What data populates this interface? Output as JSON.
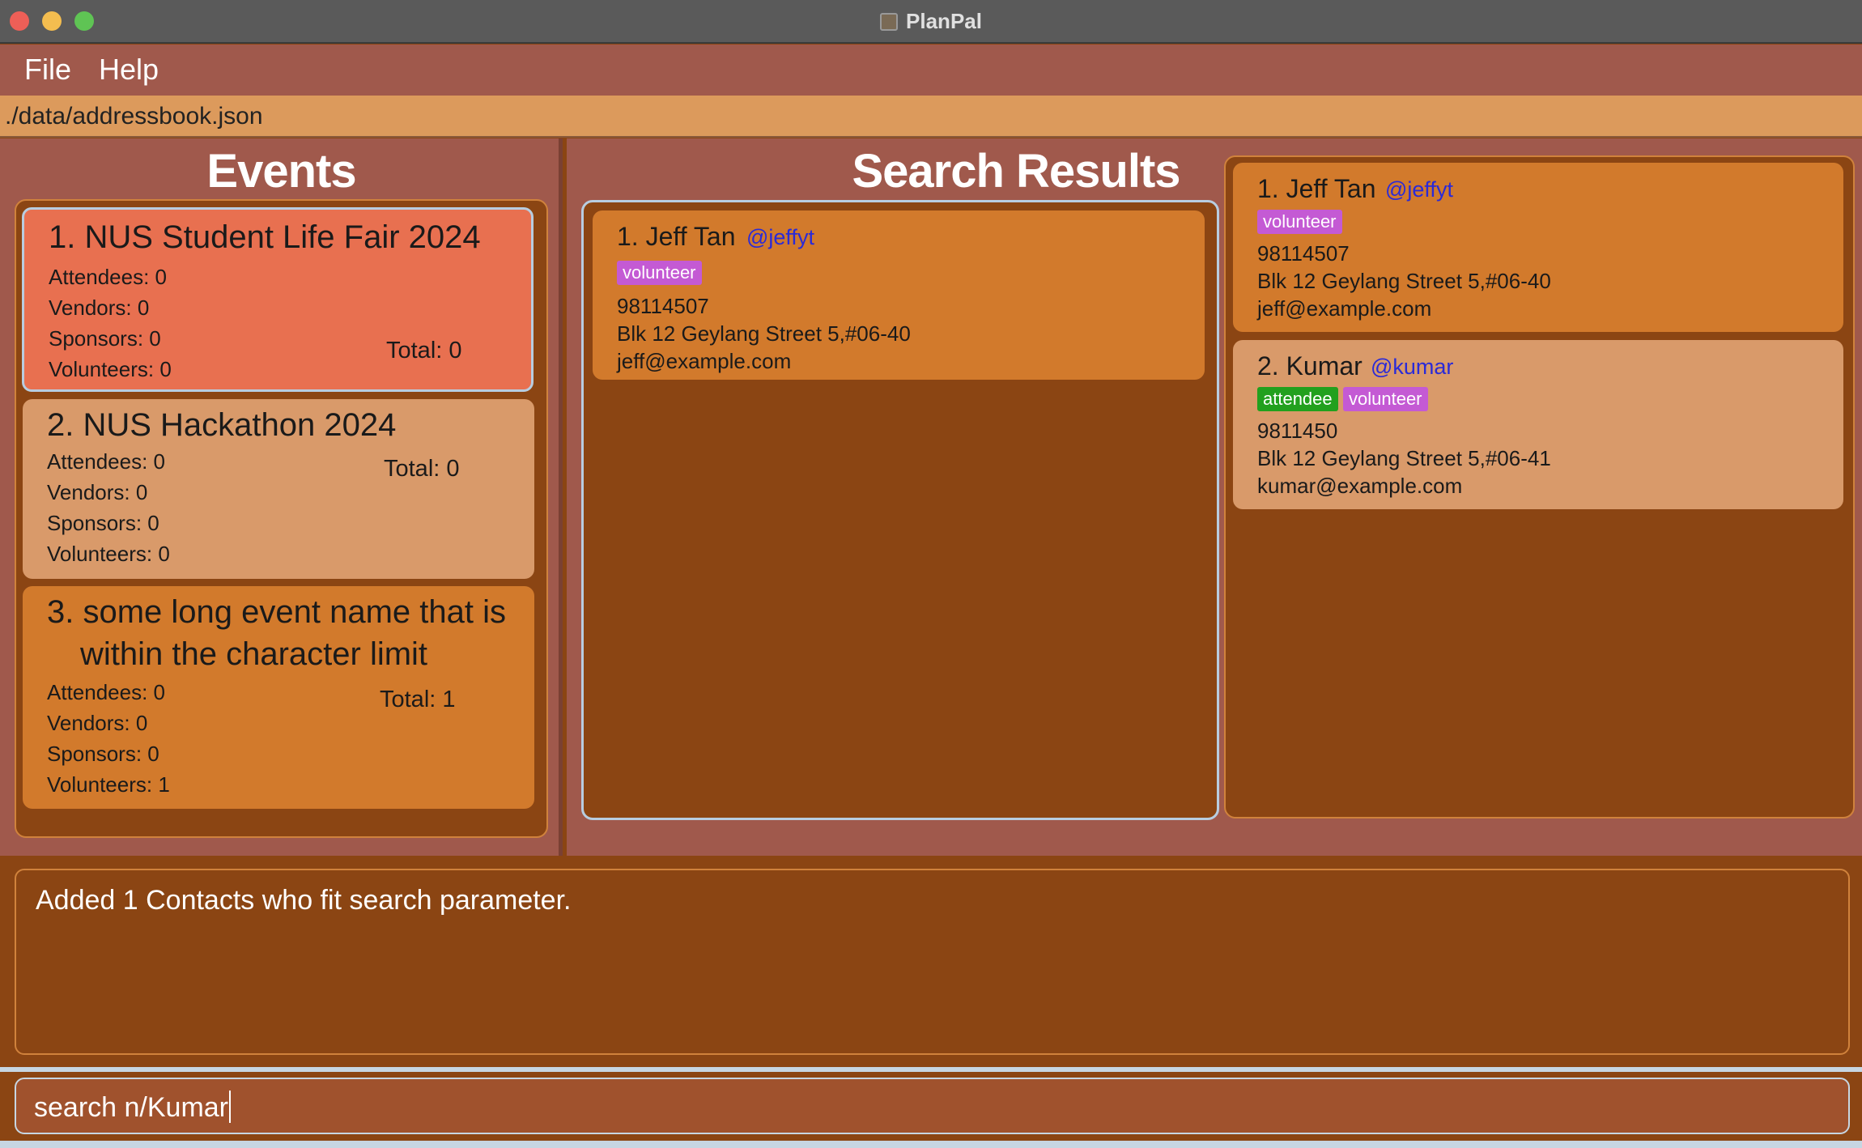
{
  "window": {
    "title": "PlanPal"
  },
  "menu": {
    "items": [
      "File",
      "Help"
    ]
  },
  "path": "./data/addressbook.json",
  "events_panel": {
    "title": "Events",
    "events": [
      {
        "name": "1. NUS Student Life Fair 2024",
        "name_line2": "",
        "attendees": "Attendees: 0",
        "vendors": "Vendors: 0",
        "sponsors": "Sponsors: 0",
        "volunteers": "Volunteers: 0",
        "total": "Total: 0",
        "selected": true
      },
      {
        "name": "2. NUS Hackathon 2024",
        "name_line2": "",
        "attendees": "Attendees: 0",
        "vendors": "Vendors: 0",
        "sponsors": "Sponsors: 0",
        "volunteers": "Volunteers: 0",
        "total": "Total: 0",
        "selected": false
      },
      {
        "name": "3. some long event name that is",
        "name_line2": "within the character limit",
        "attendees": "Attendees: 0",
        "vendors": "Vendors: 0",
        "sponsors": "Sponsors: 0",
        "volunteers": "Volunteers: 1",
        "total": "Total: 1",
        "selected": false
      }
    ]
  },
  "search_panel": {
    "title": "Search Results",
    "results": [
      {
        "name": "1. Jeff Tan",
        "handle": "@jeffyt",
        "tags": [
          "volunteer"
        ],
        "phone": "98114507",
        "address": "Blk 12 Geylang Street 5,#06-40",
        "email": "jeff@example.com"
      }
    ]
  },
  "contacts_panel": {
    "contacts": [
      {
        "name": "1. Jeff Tan",
        "handle": "@jeffyt",
        "tags": [
          "volunteer"
        ],
        "phone": "98114507",
        "address": "Blk 12 Geylang Street 5,#06-40",
        "email": "jeff@example.com"
      },
      {
        "name": "2. Kumar",
        "handle": "@kumar",
        "tags": [
          "attendee",
          "volunteer"
        ],
        "phone": "9811450",
        "address": "Blk 12 Geylang Street 5,#06-41",
        "email": "kumar@example.com"
      }
    ]
  },
  "result_display": "Added 1 Contacts who fit search parameter.",
  "command_box": {
    "value": "search n/Kumar"
  },
  "colors": {
    "selected_event": "#e87050",
    "event_card_light": "#d99a6a",
    "event_card_orange": "#d27a2c",
    "panel_bg": "#8b4513",
    "volunteer_tag": "#c45ad4",
    "attendee_tag": "#22a01e",
    "handle": "#2a2ad8"
  }
}
